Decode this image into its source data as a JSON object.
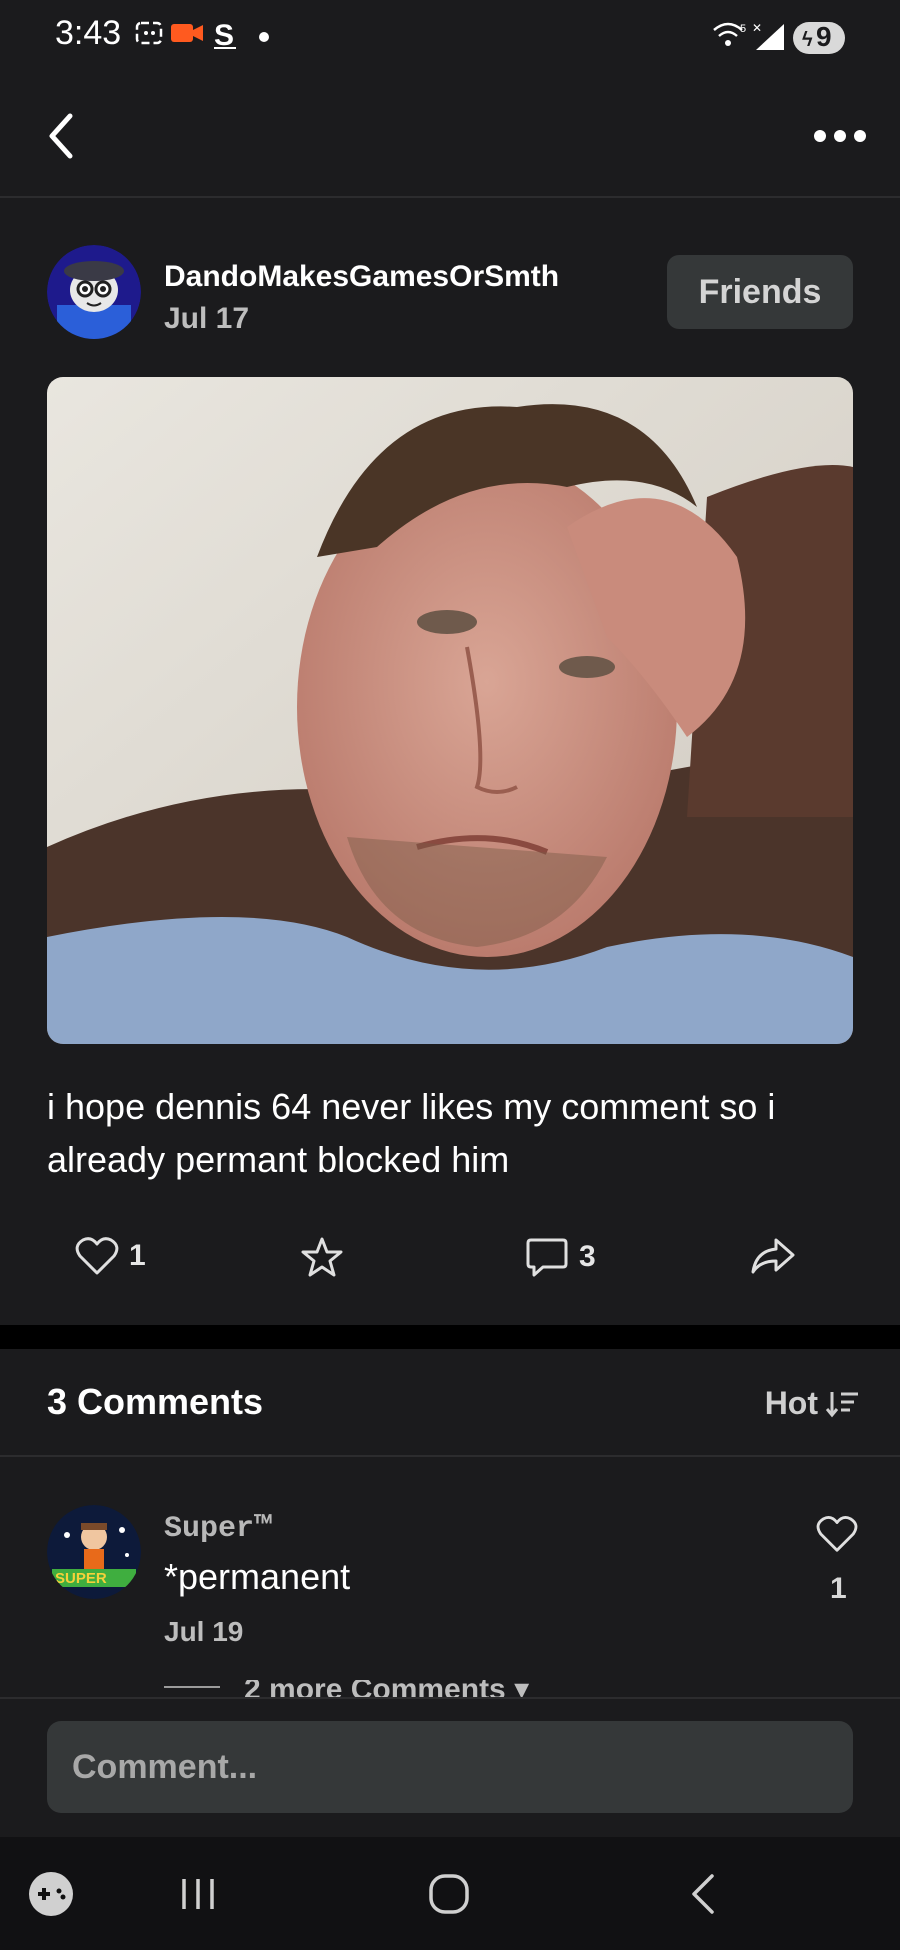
{
  "status_bar": {
    "time": "3:43",
    "battery": "9"
  },
  "post": {
    "author": "DandoMakesGamesOrSmth",
    "date": "Jul 17",
    "friend_button": "Friends",
    "text": "i hope dennis 64 never likes my comment so i already permant blocked him",
    "like_count": "1",
    "comment_count": "3"
  },
  "comments_section": {
    "title": "3 Comments",
    "sort_label": "Hot",
    "comments": [
      {
        "author": "Super™",
        "text": "*permanent",
        "date": "Jul 19",
        "like_count": "1"
      }
    ],
    "more_comments_label": "2 more Comments ▾"
  },
  "composer": {
    "placeholder": "Comment..."
  },
  "icons": {
    "back": "back-arrow-icon",
    "more": "more-options-icon",
    "like": "heart-icon",
    "favorite": "star-icon",
    "comment": "comment-bubble-icon",
    "share": "share-icon",
    "sort": "sort-icon",
    "nav_recent": "recent-apps-icon",
    "nav_home": "home-icon",
    "nav_back": "back-icon",
    "nav_game": "gamepad-icon"
  }
}
